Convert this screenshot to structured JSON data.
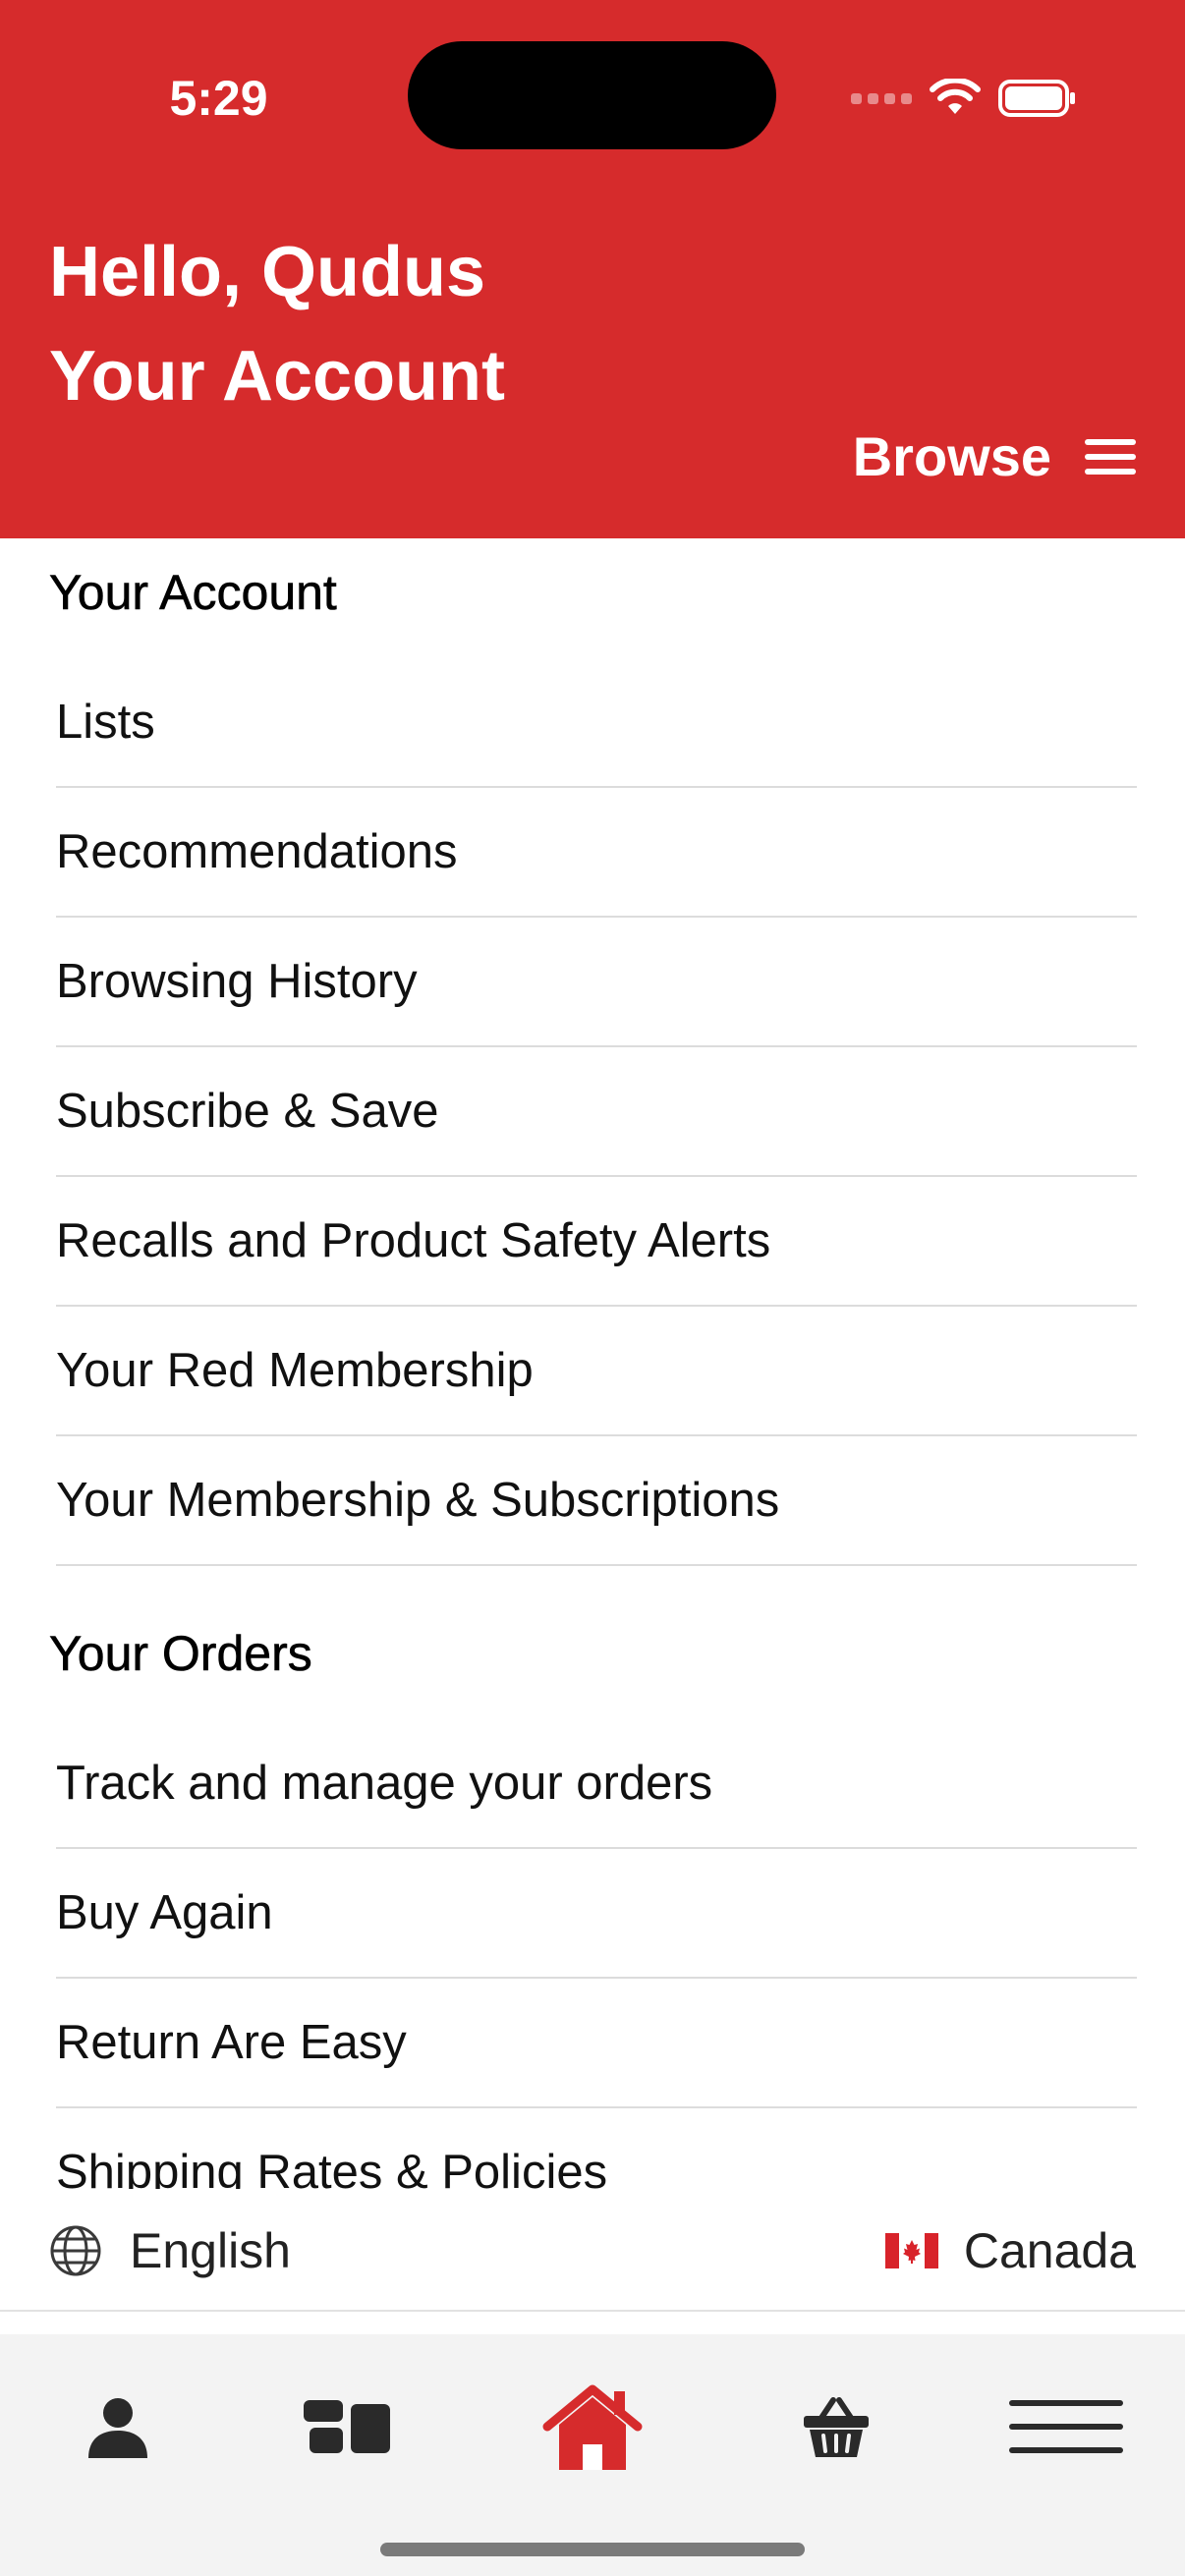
{
  "status_bar": {
    "time": "5:29"
  },
  "header": {
    "greeting": "Hello, Qudus",
    "title": "Your Account",
    "browse_label": "Browse",
    "background_color": "#d62b2c"
  },
  "sections": [
    {
      "title": "Your Account",
      "items": [
        "Lists",
        "Recommendations",
        "Browsing History",
        "Subscribe & Save",
        "Recalls and Product Safety Alerts",
        "Your Red Membership",
        "Your Membership & Subscriptions"
      ]
    },
    {
      "title": "Your Orders",
      "items": [
        "Track and manage your orders",
        "Buy Again",
        "Return Are Easy",
        "Shipping Rates & Policies"
      ]
    }
  ],
  "locale": {
    "language": "English",
    "language_icon": "globe-icon",
    "region": "Canada",
    "region_icon": "canada-flag-icon"
  },
  "tabbar": {
    "tabs": [
      {
        "name": "account",
        "icon": "person-icon",
        "active": false
      },
      {
        "name": "dashboard",
        "icon": "dashboard-icon",
        "active": false
      },
      {
        "name": "home",
        "icon": "home-icon",
        "active": true
      },
      {
        "name": "cart",
        "icon": "basket-icon",
        "active": false
      },
      {
        "name": "menu",
        "icon": "hamburger-menu-icon",
        "active": false
      }
    ],
    "active_color": "#d62b2c",
    "inactive_color": "#2a2a2a"
  }
}
